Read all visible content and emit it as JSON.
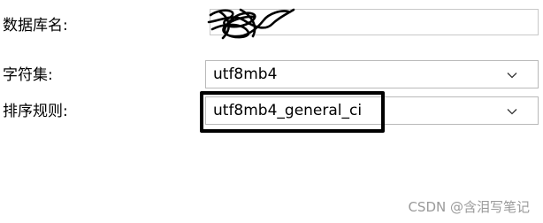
{
  "form": {
    "db_name": {
      "label": "数据库名:",
      "value": ""
    },
    "charset": {
      "label": "字符集:",
      "value": "utf8mb4",
      "icon": "chevron-down-icon"
    },
    "collation": {
      "label": "排序规则:",
      "value": "utf8mb4_general_ci",
      "icon": "chevron-down-icon"
    }
  },
  "watermark": "CSDN @含泪写笔记"
}
